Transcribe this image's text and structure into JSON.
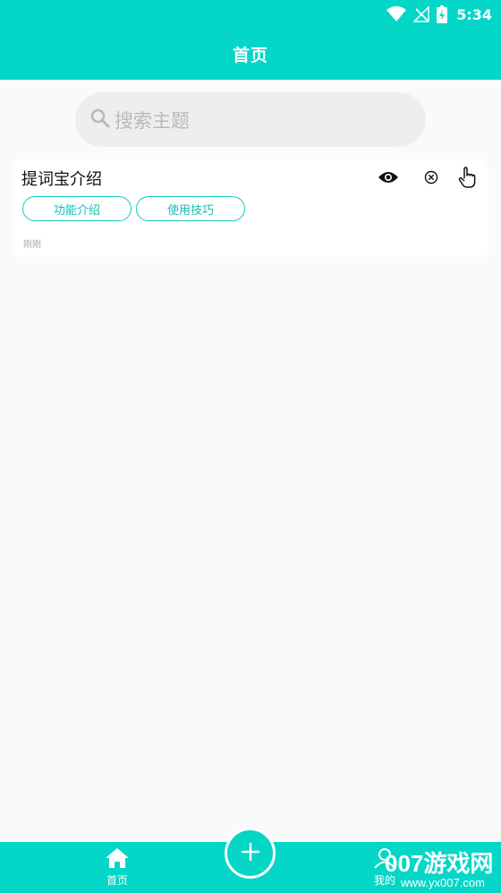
{
  "status_bar": {
    "time": "5:34"
  },
  "header": {
    "title": "首页"
  },
  "search": {
    "placeholder": "搜索主题"
  },
  "card": {
    "title": "提词宝介绍",
    "tags": [
      "功能介绍",
      "使用技巧"
    ],
    "time": "刚刚"
  },
  "bottom_nav": {
    "home_label": "首页",
    "mine_label": "我的"
  },
  "watermark": {
    "text": "007游戏网",
    "url": "www.yx007.com"
  },
  "colors": {
    "accent": "#04d6c8",
    "tag_border": "#14c7bd"
  }
}
